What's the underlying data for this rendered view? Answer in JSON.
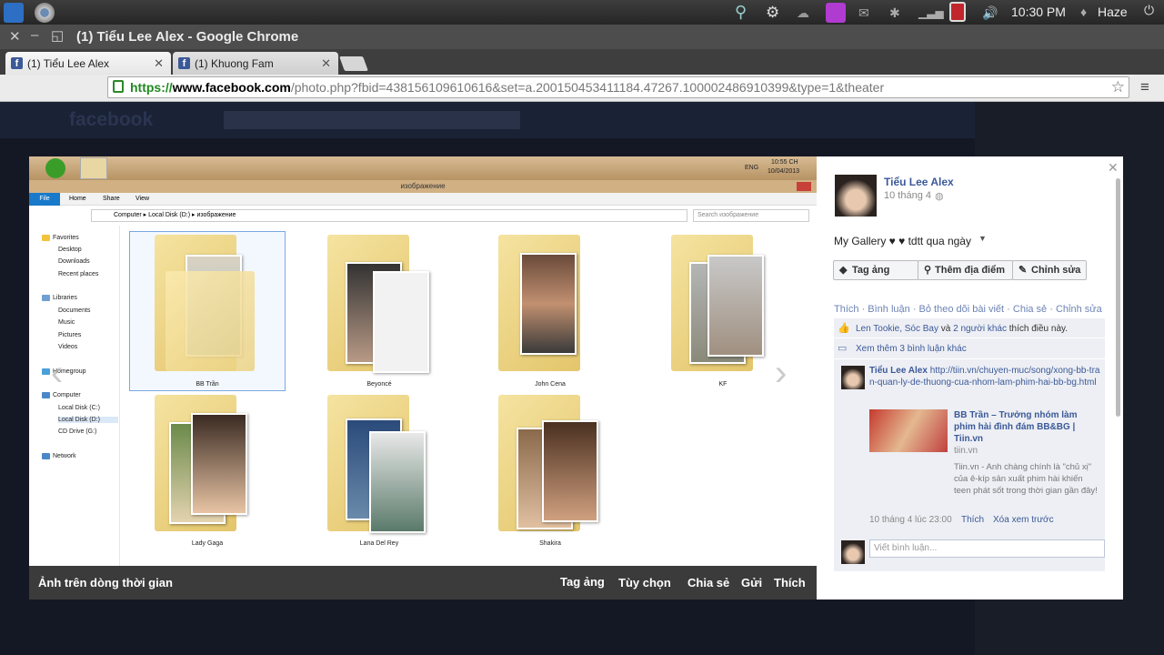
{
  "system": {
    "clock": "10:30 PM",
    "user": "Haze"
  },
  "window": {
    "title": "(1) Tiểu Lee Alex - Google Chrome"
  },
  "tabs": [
    {
      "label": "(1) Tiểu Lee Alex"
    },
    {
      "label": "(1) Khuong Fam"
    }
  ],
  "url": {
    "https": "https://",
    "domain": "www.facebook.com",
    "path": "/photo.php?fbid=438156109610616&set=a.200150453411184.47267.100002486910399&type=1&theater"
  },
  "fb": {
    "logo": "facebook"
  },
  "screenshot": {
    "clock": "10:55 CH",
    "date": "10/04/2013",
    "lang": "ENG",
    "explorer_title": "изображение",
    "ribbon": [
      "File",
      "Home",
      "Share",
      "View"
    ],
    "breadcrumb": [
      "Computer",
      "Local Disk (D:)",
      "изображение"
    ],
    "search_placeholder": "Search изображение",
    "nav": [
      "Favorites",
      "Desktop",
      "Downloads",
      "Recent places",
      "Libraries",
      "Documents",
      "Music",
      "Pictures",
      "Videos",
      "Homegroup",
      "Computer",
      "Local Disk (C:)",
      "Local Disk (D:)",
      "CD Drive (G:)",
      "Network"
    ],
    "folders": [
      "BB Trần",
      "Beyoncé",
      "John Cena",
      "KF",
      "Lady Gaga",
      "Lana Del Rey",
      "Shakira"
    ]
  },
  "photo_bar": {
    "caption": "Ảnh trên dòng thời gian",
    "actions": [
      "Tag ảng",
      "Tùy chọn",
      "Chia sẻ",
      "Gửi",
      "Thích"
    ]
  },
  "post": {
    "author": "Tiểu Lee Alex",
    "date": "10 tháng 4",
    "text": "My Gallery ♥ ♥ tdtt qua ngày",
    "buttons": [
      "Tag ảng",
      "Thêm địa điểm",
      "Chỉnh sửa"
    ],
    "actions": "Thích · Bình luận · Bỏ theo dõi bài viết · Chia sẻ · Chỉnh sửa",
    "likes_names": "Len Tookie, Sóc Bay",
    "likes_and": "và",
    "likes_more": "2 người khác",
    "likes_tail": "thích điều này.",
    "more_comments": "Xem thêm 3 bình luận khác",
    "comment_author": "Tiểu Lee Alex",
    "comment_link": "http://tiin.vn/chuyen-muc/song/xong-bb-tran-quan-ly-de-thuong-cua-nhom-lam-phim-hai-bb-bg.html",
    "share_title": "BB Trần – Trưởng nhóm làm phim hài đình đám BB&BG | Tiin.vn",
    "share_domain": "tiin.vn",
    "share_desc": "Tiin.vn - Anh chàng chính là \"chủ xị\" của ê-kíp sản xuất phim hài khiến teen phát sốt trong thời gian gần đây!",
    "comment_time": "10 tháng 4 lúc 23:00",
    "comment_like": "Thích",
    "comment_remove": "Xóa xem trước",
    "input_placeholder": "Viết bình luận..."
  }
}
